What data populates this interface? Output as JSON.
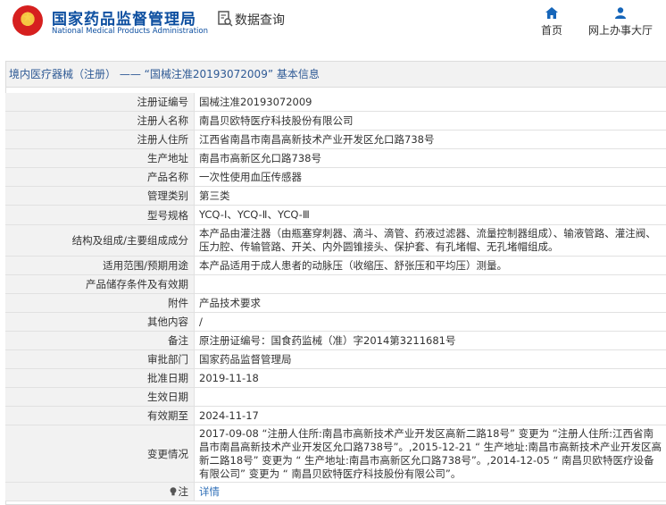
{
  "header": {
    "logo_cn": "国家药品监督管理局",
    "logo_en": "National Medical Products Administration",
    "query_label": "数据查询",
    "nav": [
      {
        "label": "首页",
        "icon": "home-icon"
      },
      {
        "label": "网上办事大厅",
        "icon": "user-icon"
      }
    ]
  },
  "panel": {
    "title": "境内医疗器械（注册） —— “国械注准20193072009” 基本信息"
  },
  "rows": [
    {
      "label": "注册证编号",
      "value": "国械注准20193072009"
    },
    {
      "label": "注册人名称",
      "value": "南昌贝欧特医疗科技股份有限公司"
    },
    {
      "label": "注册人住所",
      "value": "江西省南昌市南昌高新技术产业开发区允口路738号"
    },
    {
      "label": "生产地址",
      "value": "南昌市高新区允口路738号"
    },
    {
      "label": "产品名称",
      "value": "一次性使用血压传感器"
    },
    {
      "label": "管理类别",
      "value": "第三类"
    },
    {
      "label": "型号规格",
      "value": "YCQ-Ⅰ、YCQ-Ⅱ、YCQ-Ⅲ"
    },
    {
      "label": "结构及组成/主要组成成分",
      "value": "本产品由灌注器（由瓶塞穿刺器、滴斗、滴管、药液过滤器、流量控制器组成）、输液管路、灌注阀、压力腔、传输管路、开关、内外圆锥接头、保护套、有孔堵帽、无孔堵帽组成。"
    },
    {
      "label": "适用范围/预期用途",
      "value": "本产品适用于成人患者的动脉压（收缩压、舒张压和平均压）测量。"
    },
    {
      "label": "产品储存条件及有效期",
      "value": ""
    },
    {
      "label": "附件",
      "value": "产品技术要求"
    },
    {
      "label": "其他内容",
      "value": "/"
    },
    {
      "label": "备注",
      "value": "原注册证编号：国食药监械（准）字2014第3211681号"
    },
    {
      "label": "审批部门",
      "value": "国家药品监督管理局"
    },
    {
      "label": "批准日期",
      "value": "2019-11-18"
    },
    {
      "label": "生效日期",
      "value": ""
    },
    {
      "label": "有效期至",
      "value": "2024-11-17"
    },
    {
      "label": "变更情况",
      "value": "2017-09-08 “注册人住所:南昌市高新技术产业开发区高新二路18号” 变更为 “注册人住所:江西省南昌市南昌高新技术产业开发区允口路738号”。,2015-12-21 “ 生产地址:南昌市高新技术产业开发区高新二路18号” 变更为 “ 生产地址:南昌市高新区允口路738号”。,2014-12-05 “ 南昌贝欧特医疗设备有限公司” 变更为 “ 南昌贝欧特医疗科技股份有限公司”。"
    },
    {
      "label": "注",
      "value": "详情",
      "icon": "bulb-icon",
      "link": true
    }
  ]
}
